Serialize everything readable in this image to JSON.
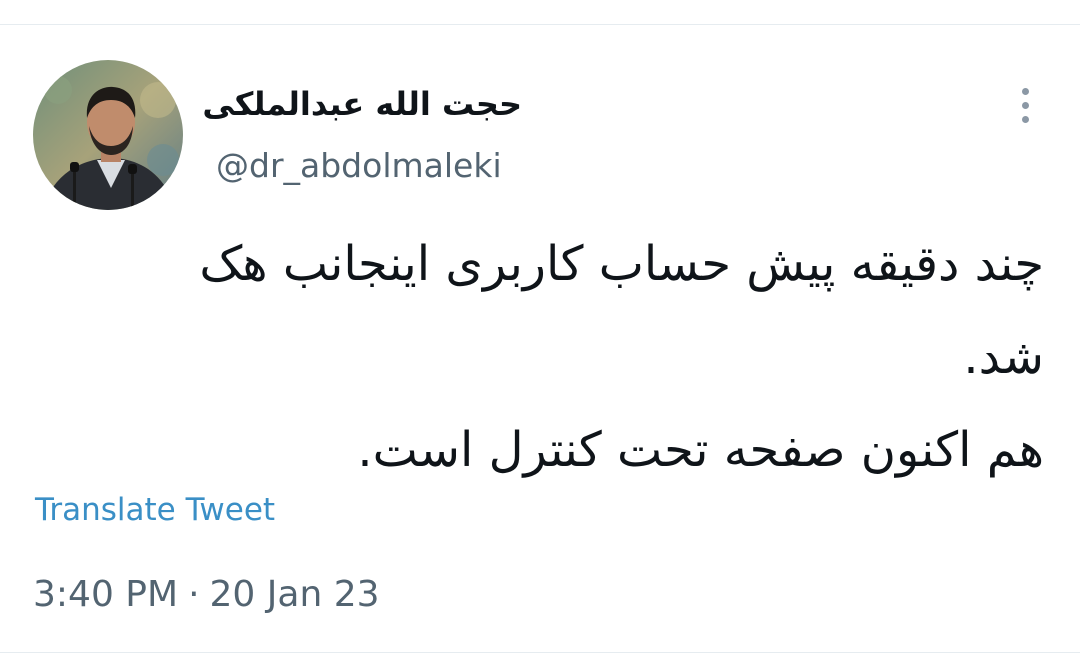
{
  "author": {
    "display_name": "حجت الله عبدالملکی",
    "handle": "@dr_abdolmaleki",
    "avatar_icon": "profile-photo"
  },
  "menu": {
    "more_icon": "more-vertical-icon"
  },
  "tweet": {
    "lines": [
      "چند دقیقه پیش حساب کاربری اینجانب هک",
      "شد.",
      "هم اکنون صفحه تحت کنترل است."
    ],
    "translate_label": "Translate Tweet",
    "time": "3:40 PM",
    "separator": "·",
    "date": "20 Jan 23"
  },
  "colors": {
    "link": "#3a8fc6",
    "secondary_text": "#536471",
    "primary_text": "#0f1419"
  }
}
